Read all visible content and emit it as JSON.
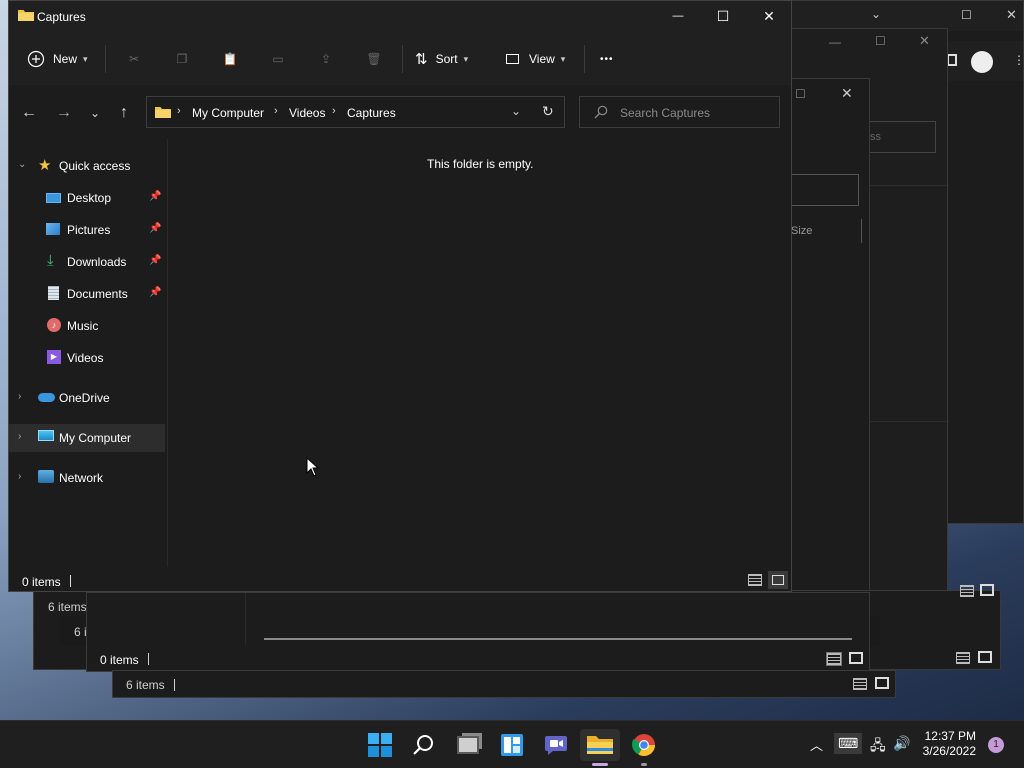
{
  "window": {
    "title": "Captures",
    "minimize": "—",
    "maximize": "☐",
    "close": "✕"
  },
  "toolbar": {
    "new_label": "New",
    "sort_label": "Sort",
    "view_label": "View",
    "more_label": "•••"
  },
  "address": {
    "segments": [
      "My Computer",
      "Videos",
      "Captures"
    ]
  },
  "search": {
    "placeholder": "Search Captures"
  },
  "sidebar": {
    "items": [
      {
        "label": "Quick access",
        "icon": "star-icon"
      },
      {
        "label": "Desktop",
        "icon": "desktop-icon",
        "pinned": true
      },
      {
        "label": "Pictures",
        "icon": "pictures-icon",
        "pinned": true
      },
      {
        "label": "Downloads",
        "icon": "downloads-icon",
        "pinned": true
      },
      {
        "label": "Documents",
        "icon": "documents-icon",
        "pinned": true
      },
      {
        "label": "Music",
        "icon": "music-icon"
      },
      {
        "label": "Videos",
        "icon": "videos-icon"
      },
      {
        "label": "OneDrive",
        "icon": "onedrive-icon"
      },
      {
        "label": "My Computer",
        "icon": "computer-icon"
      },
      {
        "label": "Network",
        "icon": "network-icon"
      }
    ]
  },
  "content": {
    "empty_message": "This folder is empty."
  },
  "status": {
    "item_count": "0 items"
  },
  "background_windows": {
    "status_a": "6 items",
    "status_b": "6 i",
    "status_c": "0 items",
    "status_d": "6 items",
    "partial_text_ss": "ss",
    "partial_text_size": "Size"
  },
  "taskbar": {
    "time": "12:37 PM",
    "date": "3/26/2022",
    "notification_count": "1"
  },
  "colors": {
    "folder_yellow": "#f4c542",
    "accent_blue": "#3a96dd",
    "chrome_red": "#db4437",
    "notification": "#c59ad6"
  }
}
